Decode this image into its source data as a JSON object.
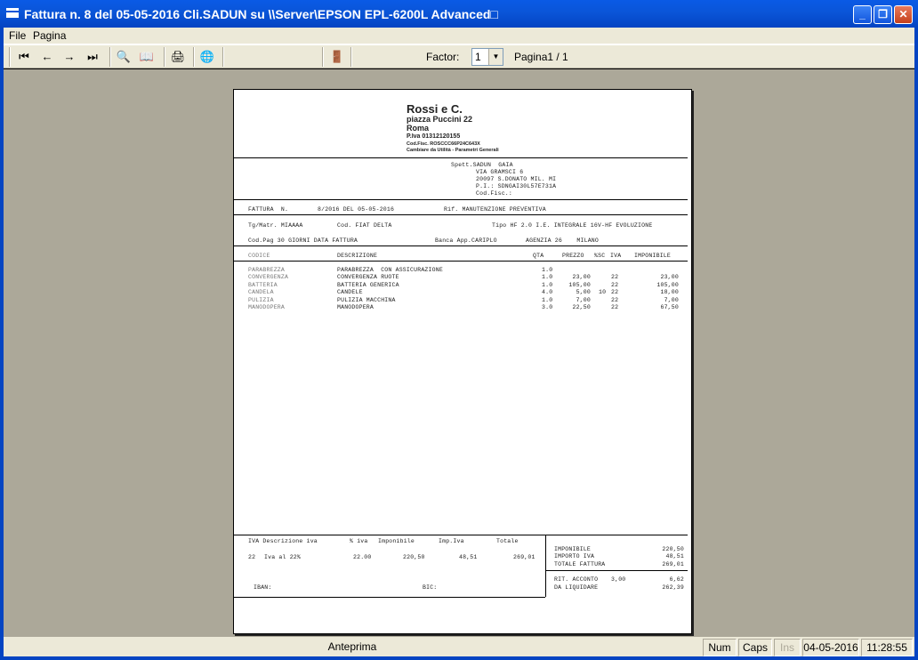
{
  "window": {
    "title": "Fattura n.   8 del 05-05-2016 Cli.SADUN su \\\\Server\\EPSON EPL-6200L Advanced□",
    "minimize": "_",
    "maximize": "❐",
    "close": "✕"
  },
  "menu": {
    "file": "File",
    "pagina": "Pagina"
  },
  "toolbar": {
    "first": "⏮",
    "prev": "←",
    "next": "→",
    "last": "⏭",
    "zoom": "🔍",
    "book": "📖",
    "print": "🖨",
    "export": "🌐",
    "exit": "🚪",
    "factor_label": "Factor:",
    "factor_value": "1",
    "page_label": "Pagina1 / 1"
  },
  "invoice": {
    "company": {
      "name": "Rossi e C.",
      "address": "piazza Puccini 22",
      "city": "Roma",
      "piva": "P.Iva 01312120155",
      "codfisc": "Cod.Fisc. ROSCCC66P24C643X",
      "note": "Cambiare da Utilità - Parametri Generali"
    },
    "customer": {
      "line1": "Spett.SADUN  GAIA",
      "line2": "VIA GRAMSCI 6",
      "line3": "20097 S.DONATO MIL. MI",
      "line4": "P.I.: SDNGAI30L57E731A",
      "line5": "Cod.Fisc.:"
    },
    "header": {
      "fattura_label": "FATTURA  N.",
      "fattura_value": "8/2016 DEL 05-05-2016",
      "rif": "Rif. MANUTENZIONE PREVENTIVA",
      "targa": "Tg/Matr. MIAAAA",
      "cod": "Cod. FIAT DELTA",
      "tipo": "Tipo HF 2.0 I.E. INTEGRALE 16V-HF EVOLUZIONE",
      "pag": "Cod.Pag 30 GIORNI DATA FATTURA",
      "banca": "Banca App.CARIPLO",
      "agenzia": "AGENZIA 26    MILANO"
    },
    "columns": {
      "codice": "CODICE",
      "descrizione": "DESCRIZIONE",
      "qta": "QTA",
      "prezzo": "PREZZO",
      "sc": "%SC",
      "iva": "IVA",
      "imponibile": "IMPONIBILE"
    },
    "rows": [
      {
        "codice": "PARABREZZA",
        "descrizione": "PARABREZZA  CON ASSICURAZIONE",
        "qta": "1.0",
        "prezzo": "",
        "sc": "",
        "iva": "",
        "imponibile": ""
      },
      {
        "codice": "CONVERGENZA",
        "descrizione": "CONVERGENZA RUOTE",
        "qta": "1.0",
        "prezzo": "23,00",
        "sc": "",
        "iva": "22",
        "imponibile": "23,00"
      },
      {
        "codice": "BATTERIA",
        "descrizione": "BATTERIA GENERICA",
        "qta": "1.0",
        "prezzo": "105,00",
        "sc": "",
        "iva": "22",
        "imponibile": "105,00"
      },
      {
        "codice": "CANDELA",
        "descrizione": "CANDELE",
        "qta": "4.0",
        "prezzo": "5,00",
        "sc": "10",
        "iva": "22",
        "imponibile": "18,00"
      },
      {
        "codice": "PULIZIA",
        "descrizione": "PULIZIA MACCHINA",
        "qta": "1.0",
        "prezzo": "7,00",
        "sc": "",
        "iva": "22",
        "imponibile": "7,00"
      },
      {
        "codice": "MANODOPERA",
        "descrizione": "MANODOPERA",
        "qta": "3.0",
        "prezzo": "22,50",
        "sc": "",
        "iva": "22",
        "imponibile": "67,50"
      }
    ],
    "iva_table": {
      "h_iva": "IVA Descrizione iva",
      "h_perc": "% iva",
      "h_imponibile": "Imponibile",
      "h_impiva": "Imp.Iva",
      "h_totale": "Totale",
      "code": "22",
      "desc": "Iva al 22%",
      "perc": "22.00",
      "imponibile": "220,50",
      "impiva": "48,51",
      "totale": "269,01"
    },
    "iban": "IBAN:",
    "bic": "BIC:",
    "totals": {
      "imponibile_label": "IMPONIBILE",
      "imponibile": "220,50",
      "iva_label": "IMPORTO IVA",
      "iva": "48,51",
      "totale_label": "TOTALE FATTURA",
      "totale": "269,01",
      "ritenuta_label": "RIT. ACCONTO",
      "ritenuta_perc": "3,00",
      "ritenuta": "6,62",
      "liquidare_label": "DA LIQUIDARE",
      "liquidare": "262,39"
    }
  },
  "status": {
    "mode": "Anteprima",
    "num": "Num",
    "caps": "Caps",
    "ins": "Ins",
    "date": "04-05-2016",
    "time": "11:28:55"
  }
}
